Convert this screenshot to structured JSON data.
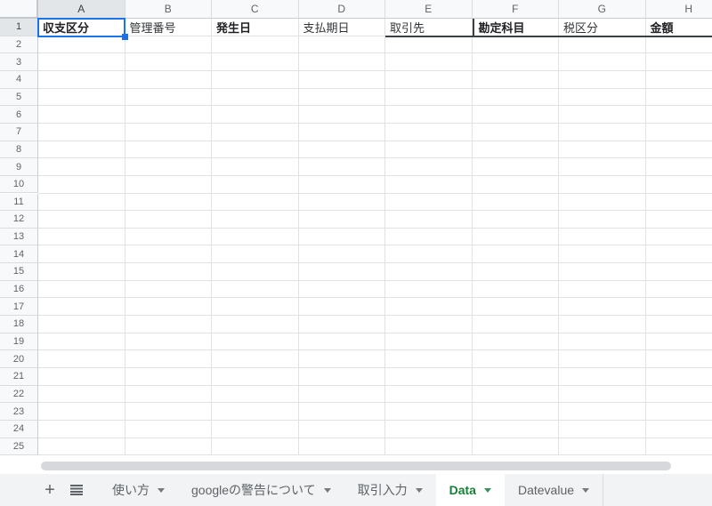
{
  "sheet": {
    "columns": [
      "A",
      "B",
      "C",
      "D",
      "E",
      "F",
      "G",
      "H"
    ],
    "row_numbers": [
      1,
      2,
      3,
      4,
      5,
      6,
      7,
      8,
      9,
      10,
      11,
      12,
      13,
      14,
      15,
      16,
      17,
      18,
      19,
      20,
      21,
      22,
      23,
      24,
      25
    ],
    "selected_cell": "A1",
    "selected_column": "A",
    "selected_row": 1,
    "header_row": [
      {
        "col": "A",
        "text": "収支区分",
        "bold": true,
        "border_bottom": false,
        "border_left": false
      },
      {
        "col": "B",
        "text": "管理番号",
        "bold": false,
        "border_bottom": false,
        "border_left": false
      },
      {
        "col": "C",
        "text": "発生日",
        "bold": true,
        "border_bottom": false,
        "border_left": false
      },
      {
        "col": "D",
        "text": "支払期日",
        "bold": false,
        "border_bottom": false,
        "border_left": false
      },
      {
        "col": "E",
        "text": "取引先",
        "bold": false,
        "border_bottom": true,
        "border_left": false
      },
      {
        "col": "F",
        "text": "勘定科目",
        "bold": true,
        "border_bottom": true,
        "border_left": true
      },
      {
        "col": "G",
        "text": "税区分",
        "bold": false,
        "border_bottom": true,
        "border_left": false
      },
      {
        "col": "H",
        "text": "金額",
        "bold": true,
        "border_bottom": true,
        "border_left": false
      }
    ]
  },
  "tabbar": {
    "add_sheet_label": "+",
    "tabs": [
      {
        "label": "使い方",
        "active": false
      },
      {
        "label": "googleの警告について",
        "active": false
      },
      {
        "label": "取引入力",
        "active": false
      },
      {
        "label": "Data",
        "active": true
      },
      {
        "label": "Datevalue",
        "active": false
      }
    ]
  },
  "colors": {
    "selection_blue": "#1a73e8",
    "active_tab_green": "#188038",
    "custom_border_dark": "#3c4043",
    "header_bg": "#f8f9fa",
    "selected_header_bg": "#e3e6e9",
    "gridline": "#e2e2e2",
    "tabbar_bg": "#f1f3f4",
    "scroll_thumb": "#d6d8db"
  }
}
